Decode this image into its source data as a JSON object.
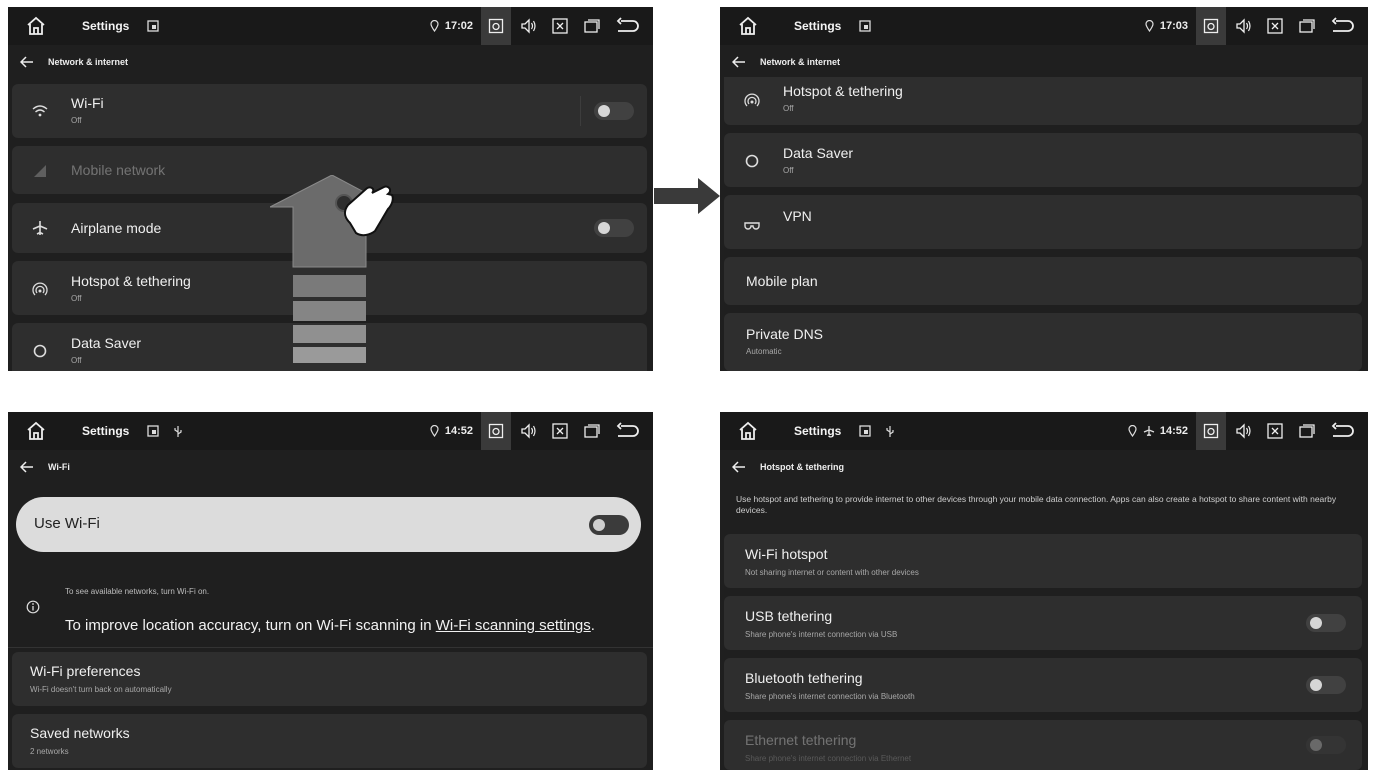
{
  "screens": {
    "s1": {
      "status": {
        "title": "Settings",
        "time": "17:02"
      },
      "nav_title": "Network & internet",
      "items": [
        {
          "title": "Wi-Fi",
          "subtitle": "Off"
        },
        {
          "title": "Mobile network"
        },
        {
          "title": "Airplane mode"
        },
        {
          "title": "Hotspot & tethering",
          "subtitle": "Off"
        },
        {
          "title": "Data Saver",
          "subtitle": "Off"
        }
      ]
    },
    "s2": {
      "status": {
        "title": "Settings",
        "time": "17:03"
      },
      "nav_title": "Network & internet",
      "items": [
        {
          "title": "Hotspot & tethering",
          "subtitle": "Off"
        },
        {
          "title": "Data Saver",
          "subtitle": "Off"
        },
        {
          "title": "VPN"
        },
        {
          "title": "Mobile plan"
        },
        {
          "title": "Private DNS",
          "subtitle": "Automatic"
        }
      ]
    },
    "s3": {
      "status": {
        "title": "Settings",
        "time": "14:52"
      },
      "nav_title": "Wi-Fi",
      "use_wifi": "Use Wi-Fi",
      "info_small": "To see available networks, turn Wi-Fi on.",
      "info_big_pre": "To improve location accuracy, turn on Wi-Fi scanning in ",
      "info_big_link": "Wi-Fi scanning settings",
      "info_big_post": ".",
      "items": [
        {
          "title": "Wi-Fi preferences",
          "subtitle": "Wi-Fi doesn't turn back on automatically"
        },
        {
          "title": "Saved networks",
          "subtitle": "2 networks"
        }
      ]
    },
    "s4": {
      "status": {
        "title": "Settings",
        "time": "14:52"
      },
      "nav_title": "Hotspot & tethering",
      "description": "Use hotspot and tethering to provide internet to other devices through your mobile data connection. Apps can also create a hotspot to share content with nearby devices.",
      "items": [
        {
          "title": "Wi-Fi hotspot",
          "subtitle": "Not sharing internet or content with other devices"
        },
        {
          "title": "USB tethering",
          "subtitle": "Share phone's internet connection via USB"
        },
        {
          "title": "Bluetooth tethering",
          "subtitle": "Share phone's internet connection via Bluetooth"
        },
        {
          "title": "Ethernet tethering",
          "subtitle": "Share phone's internet connection via Ethernet"
        }
      ]
    }
  },
  "colors": {
    "screen_bg": "#1f1f1f",
    "card_bg": "#2e2e2e",
    "statusbar_bg": "#191919",
    "use_wifi_bg": "#dcdcdc"
  },
  "icons": [
    "home-icon",
    "window-icon",
    "usb-icon",
    "location-icon",
    "camera-icon",
    "volume-icon",
    "close-box-icon",
    "recents-icon",
    "back-icon",
    "wifi-icon",
    "signal-icon",
    "airplane-icon",
    "hotspot-icon",
    "data-saver-icon",
    "vpn-icon",
    "info-icon",
    "swipe-up-hand-icon",
    "right-arrow-icon"
  ]
}
